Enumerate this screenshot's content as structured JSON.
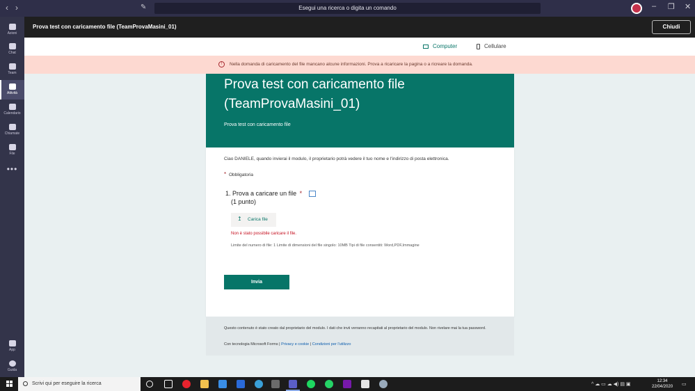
{
  "window": {
    "search_placeholder": "Esegui una ricerca o digita un comando",
    "back": "‹",
    "forward": "›",
    "minimize": "–",
    "maximize": "❐",
    "close": "✕"
  },
  "rail": {
    "items": [
      {
        "label": "Azioni",
        "icon": "bell-icon"
      },
      {
        "label": "Chat",
        "icon": "chat-icon"
      },
      {
        "label": "Team",
        "icon": "team-icon"
      },
      {
        "label": "Attività",
        "icon": "assignments-icon",
        "active": true
      },
      {
        "label": "Calendario",
        "icon": "calendar-icon"
      },
      {
        "label": "Chiamate",
        "icon": "phone-icon"
      },
      {
        "label": "File",
        "icon": "file-icon"
      }
    ],
    "more": "•••",
    "bottom": [
      {
        "label": "App",
        "icon": "apps-icon"
      },
      {
        "label": "Guida",
        "icon": "help-icon"
      }
    ]
  },
  "header": {
    "title": "Prova test con caricamento file (TeamProvaMasini_01)",
    "close_label": "Chiudi"
  },
  "devices": {
    "computer": "Computer",
    "mobile": "Cellulare"
  },
  "banner": {
    "icon": "!",
    "text": "Nella domanda di caricamento del file mancano alcune informazioni. Prova a ricaricare la pagina o a ricreare la domanda."
  },
  "form": {
    "title": "Prova test con caricamento file (TeamProvaMasini_01)",
    "subtitle": "Prova test con caricamento file",
    "greeting": "Ciao DANIELE, quando invierai il modulo, il proprietario potrà vedere il tuo nome e l'indirizzo di posta elettronica.",
    "required_star": "*",
    "required_label": "Obbligatoria",
    "question": {
      "number": "1.",
      "text": "Prova a caricare un file",
      "star": "*",
      "points": "(1 punto)"
    },
    "upload_label": "Carica file",
    "upload_icon": "↥",
    "error": "Non è stato possibile caricare il file.",
    "limits": "Limite del numero di file: 1    Limite di dimensioni del file singolo: 10MB    Tipi di file consentiti: Word,PDF,Immagine",
    "submit_label": "Invia"
  },
  "footer": {
    "notice": "Questo contenuto è stato creato dal proprietario del modulo. I dati che invii verranno recapitati al proprietario del modulo. Non rivelare mai la tua password.",
    "powered": "Con tecnologia Microsoft Forms |",
    "privacy": "Privacy e cookie",
    "sep": "|",
    "terms": "Condizioni per l'utilizzo"
  },
  "taskbar": {
    "search_placeholder": "Scrivi qui per eseguire la ricerca",
    "time": "12:34",
    "date": "22/04/2020",
    "tray": "^  ☁  ▭  ☁  ◀)  ▤  ▣"
  },
  "colors": {
    "accent": "#077568",
    "titlebar": "#2f2f49",
    "rail": "#33344a",
    "banner": "#fdd9d1",
    "error": "#c50f1f"
  }
}
